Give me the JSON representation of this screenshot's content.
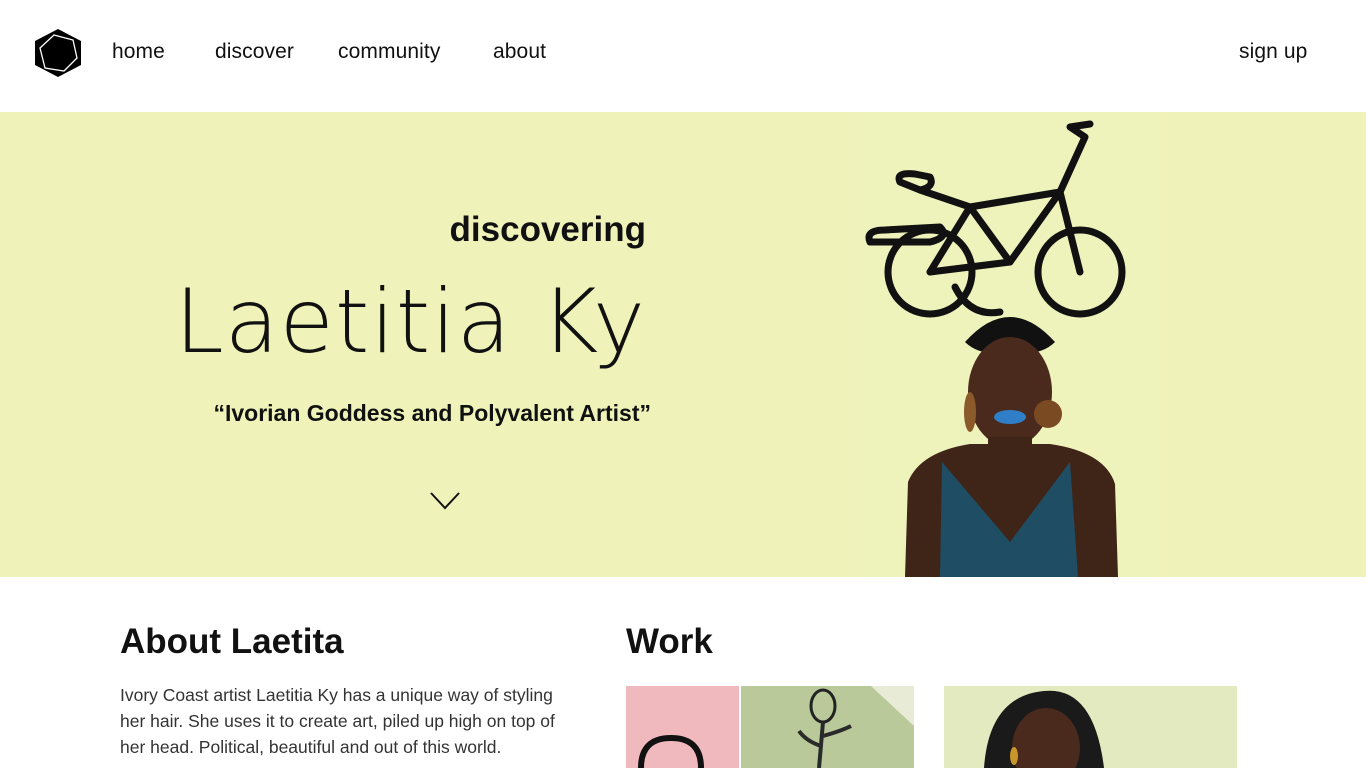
{
  "nav": {
    "logo_icon": "hexagon-logo-icon",
    "links": [
      "home",
      "discover",
      "community",
      "about"
    ],
    "signup_label": "sign up"
  },
  "hero": {
    "kicker": "discovering",
    "name": "Laetitia Ky",
    "tagline": "“Ivorian Goddess and Polyvalent Artist”",
    "scroll_icon": "chevron-down-icon",
    "background_color": "#f0f3b9"
  },
  "about": {
    "heading": "About Laetita",
    "text": "Ivory Coast artist Laetitia Ky has a unique way of styling her hair. She uses it to create art, piled up high on top of her head. Political, beautiful and out of this world."
  },
  "work": {
    "heading": "Work"
  },
  "colors": {
    "hero_bg": "#f0f3b9",
    "text": "#111111",
    "thumb_pink": "#f0b9bd",
    "thumb_green": "#b9c99a"
  }
}
